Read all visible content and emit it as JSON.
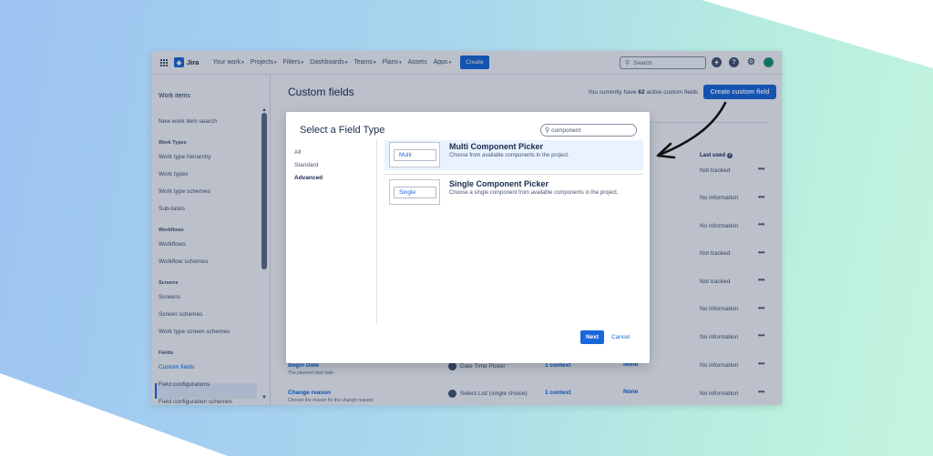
{
  "topnav": {
    "brand": "Jira",
    "items": [
      "Your work",
      "Projects",
      "Filters",
      "Dashboards",
      "Teams",
      "Plans",
      "Assets",
      "Apps"
    ],
    "has_dropdown": [
      true,
      true,
      true,
      true,
      true,
      true,
      false,
      true
    ],
    "create_label": "Create",
    "search_placeholder": "Search"
  },
  "sidebar": {
    "title": "Work items",
    "entries": [
      {
        "kind": "item",
        "label": "New work item search"
      },
      {
        "kind": "head",
        "label": "Work Types"
      },
      {
        "kind": "item",
        "label": "Work type hierarchy"
      },
      {
        "kind": "item",
        "label": "Work types"
      },
      {
        "kind": "item",
        "label": "Work type schemes"
      },
      {
        "kind": "item",
        "label": "Sub-tasks"
      },
      {
        "kind": "head",
        "label": "Workflows"
      },
      {
        "kind": "item",
        "label": "Workflows"
      },
      {
        "kind": "item",
        "label": "Workflow schemes"
      },
      {
        "kind": "head",
        "label": "Screens"
      },
      {
        "kind": "item",
        "label": "Screens"
      },
      {
        "kind": "item",
        "label": "Screen schemes"
      },
      {
        "kind": "item",
        "label": "Work type screen schemes"
      },
      {
        "kind": "head",
        "label": "Fields"
      },
      {
        "kind": "item",
        "label": "Custom fields",
        "active": true
      },
      {
        "kind": "item",
        "label": "Field configurations"
      },
      {
        "kind": "item",
        "label": "Field configuration schemes"
      }
    ]
  },
  "main": {
    "title": "Custom fields",
    "count_prefix": "You currently have",
    "count_value": "62",
    "count_suffix": "active custom fields",
    "create_button": "Create custom field",
    "last_used_header": "Last used",
    "last_used_values": [
      "Not tracked",
      "No information",
      "No information",
      "Not tracked",
      "Not tracked",
      "No information",
      "No information",
      "No information",
      "No information"
    ],
    "rows": [
      {
        "name": "Begin Date",
        "description": "The planned start date",
        "type": "Date Time Picker",
        "context": "1 context",
        "screens": "None",
        "last_used": "No information"
      },
      {
        "name": "Change reason",
        "description": "Choose the reason for the change request",
        "type": "Select List (single choice)",
        "context": "1 context",
        "screens": "None",
        "last_used": "No information"
      }
    ]
  },
  "modal": {
    "title": "Select a Field Type",
    "search_value": "component",
    "categories": [
      "All",
      "Standard",
      "Advanced"
    ],
    "active_category": "Advanced",
    "field_types": [
      {
        "thumb_label": "Multi",
        "name": "Multi Component Picker",
        "description": "Choose from available components in the project.",
        "selected": true
      },
      {
        "thumb_label": "Single",
        "name": "Single Component Picker",
        "description": "Choose a single component from available components in the project.",
        "selected": false
      }
    ],
    "next_label": "Next",
    "cancel_label": "Cancel"
  },
  "colors": {
    "accent": "#1868db",
    "annotation_arrow": "#111111"
  }
}
